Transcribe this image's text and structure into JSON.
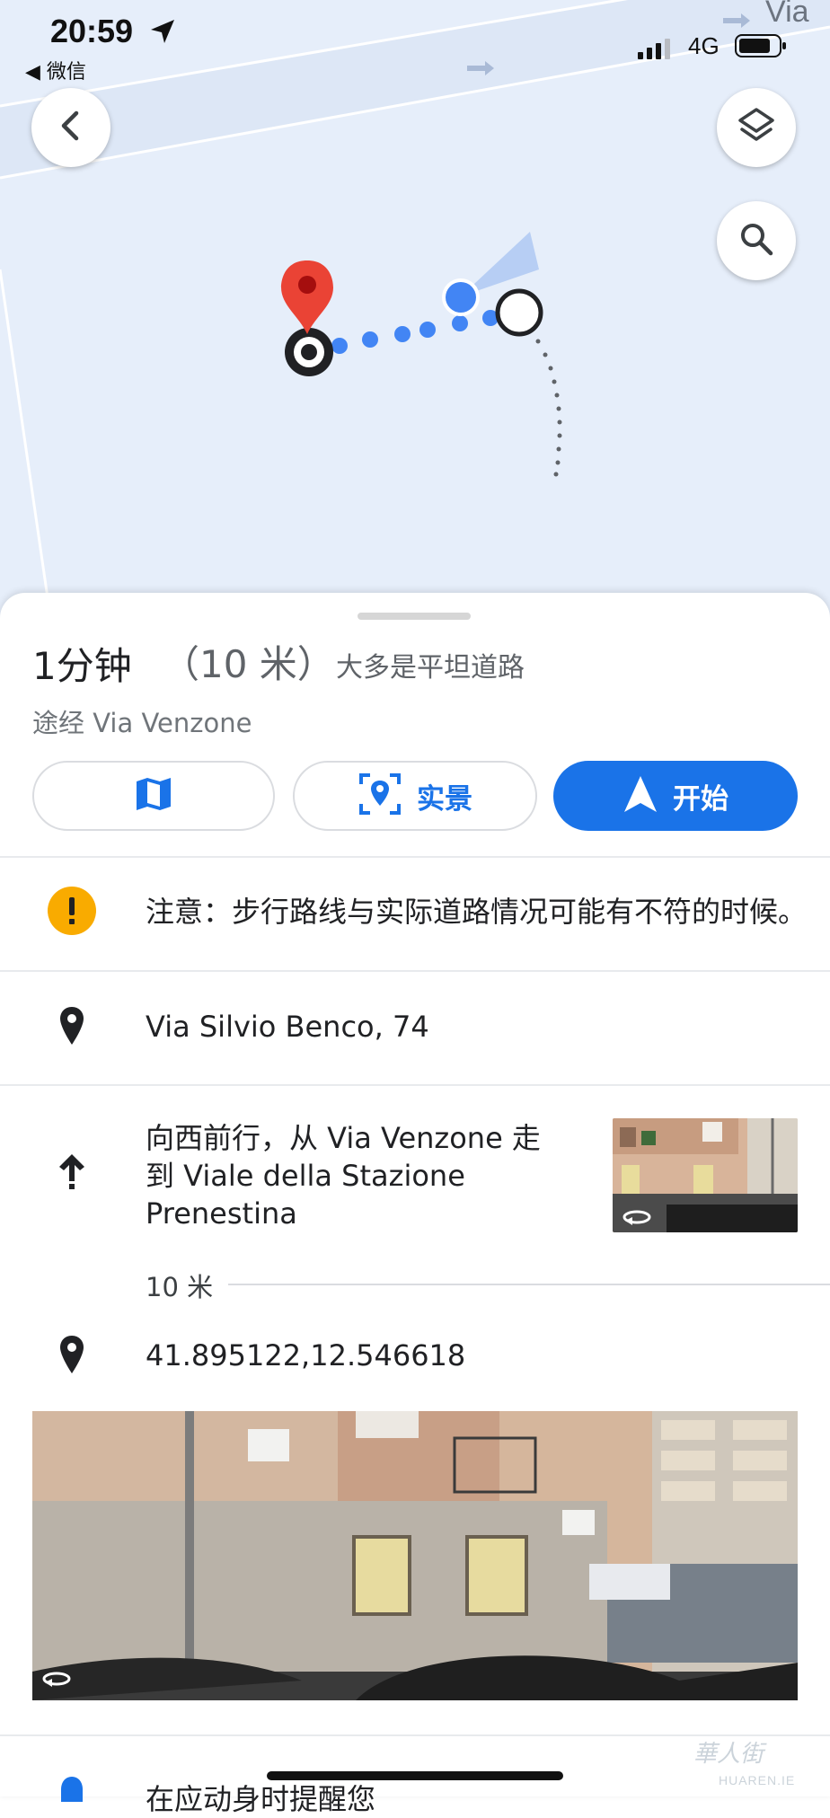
{
  "status_bar": {
    "time": "20:59",
    "back_app": "◀ 微信",
    "network": "4G"
  },
  "map": {
    "street_label": "Via",
    "buttons": {
      "back_icon": "chevron-left-icon",
      "layers_icon": "layers-icon",
      "search_icon": "search-icon"
    },
    "colors": {
      "background": "#e6eefa",
      "route_dots": "#4285f4",
      "destination_pin": "#ea4335"
    }
  },
  "summary": {
    "duration": "1分钟",
    "distance": "（10 米）",
    "terrain": "大多是平坦道路",
    "via": "途经 Via Venzone"
  },
  "actions": {
    "map_view_icon": "map-icon",
    "live_view_label": "实景",
    "start_label": "开始",
    "accent": "#1a73e8"
  },
  "steps": {
    "warning": "注意：步行路线与实际道路情况可能有不符的时候。",
    "origin": "Via Silvio Benco, 74",
    "instruction_lines": [
      "向西前行，从 Via Venzone 走",
      "到 Viale della Stazione",
      "Prenestina"
    ],
    "step_distance": "10 米",
    "destination": "41.895122,12.546618",
    "reminder": "在应动身时提醒您"
  },
  "watermark": {
    "main": "華人街",
    "sub": "HUAREN.IE"
  }
}
